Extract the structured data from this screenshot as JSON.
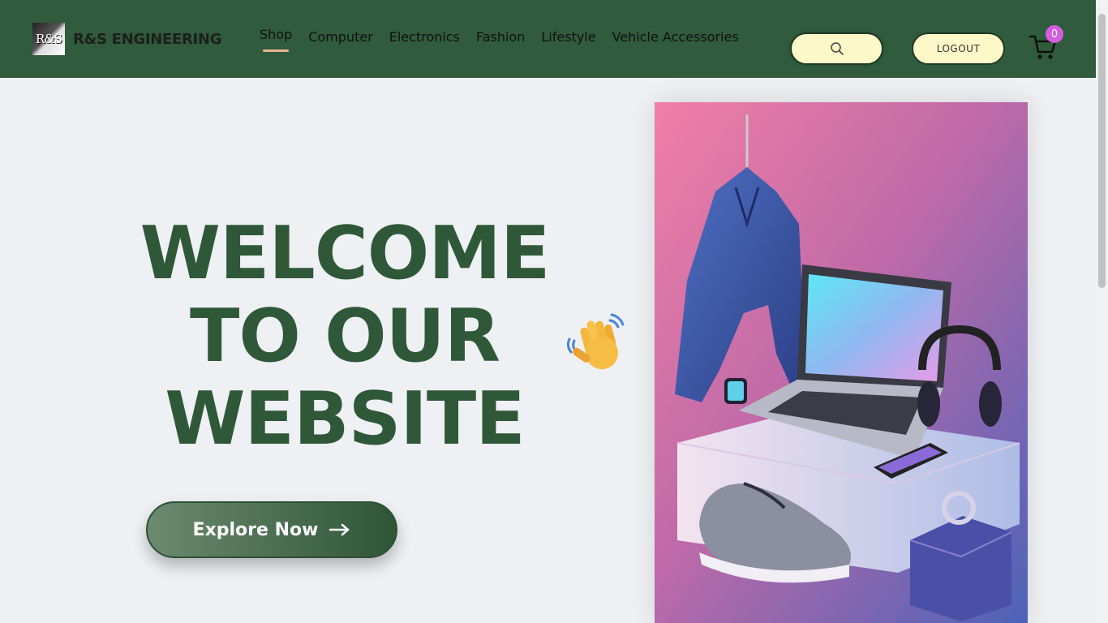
{
  "header": {
    "logo_text": "R&S",
    "brand_name": "R&S ENGINEERING",
    "nav": [
      {
        "label": "Shop",
        "active": true
      },
      {
        "label": "Computer"
      },
      {
        "label": "Electronics"
      },
      {
        "label": "Fashion"
      },
      {
        "label": "Lifestyle"
      },
      {
        "label": "Vehicle Accessories"
      }
    ],
    "search_icon": "search-icon",
    "logout_label": "LOGOUT",
    "cart_icon": "cart-icon",
    "cart_count": "0"
  },
  "hero": {
    "title_lines": [
      "WELCOME",
      "TO OUR",
      "WEBSITE"
    ],
    "wave_icon": "waving-hand-icon",
    "cta_label": "Explore Now",
    "cta_icon": "arrow-right-icon",
    "image_subject": "product-showcase-illustration"
  },
  "colors": {
    "header_bg": "#305b3c",
    "accent_green": "#2f5838",
    "button_cream": "#fdf8c8",
    "badge_pink": "#d55de0",
    "nav_underline": "#e9b48c"
  }
}
